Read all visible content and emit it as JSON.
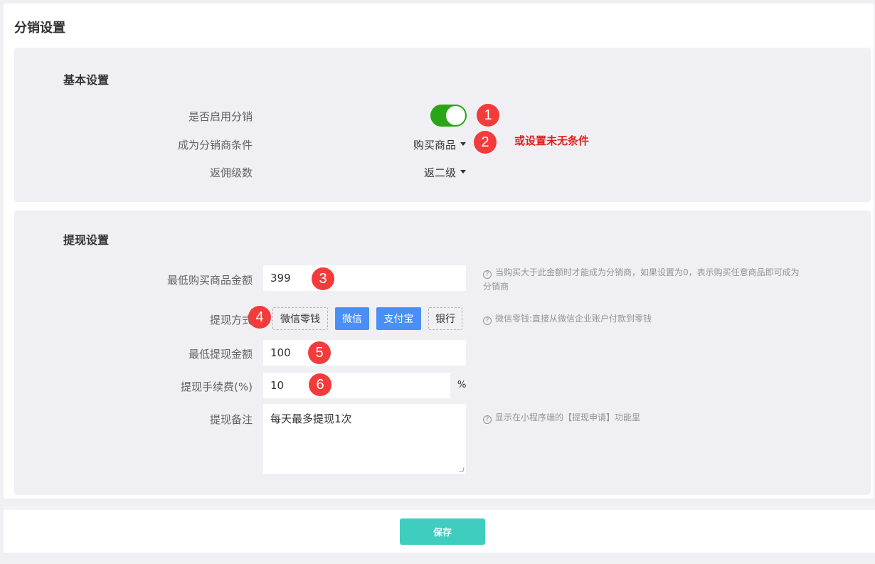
{
  "page_title": "分销设置",
  "basic": {
    "title": "基本设置",
    "enable_label": "是否启用分销",
    "enable_value": true,
    "condition_label": "成为分销商条件",
    "condition_value": "购买商品",
    "condition_note": "或设置未无条件",
    "level_label": "返佣级数",
    "level_value": "返二级"
  },
  "withdraw": {
    "title": "提现设置",
    "min_purchase_label": "最低购买商品金额",
    "min_purchase_value": "399",
    "min_purchase_hint": "当购买大于此金额时才能成为分销商，如果设置为0，表示购买任意商品即可成为",
    "min_purchase_hint_2": "分销商",
    "method_label": "提现方式",
    "methods": [
      {
        "label": "微信零钱",
        "selected": false
      },
      {
        "label": "微信",
        "selected": true
      },
      {
        "label": "支付宝",
        "selected": true
      },
      {
        "label": "银行",
        "selected": false
      }
    ],
    "method_hint": "微信零钱:直接从微信企业账户付款到零钱",
    "min_withdraw_label": "最低提现金额",
    "min_withdraw_value": "100",
    "fee_label": "提现手续费(%)",
    "fee_value": "10",
    "fee_unit": "%",
    "remark_label": "提现备注",
    "remark_value": "每天最多提现1次",
    "remark_hint": "显示在小程序端的【提现申请】功能里"
  },
  "badges": [
    "1",
    "2",
    "3",
    "4",
    "5",
    "6"
  ],
  "footer": {
    "save_label": "保存"
  },
  "colors": {
    "toggle_on": "#2aa515",
    "badge": "#f23b3b",
    "chip_active": "#4a8ff5",
    "save_button": "#3ecdbe",
    "note": "#e02020"
  }
}
